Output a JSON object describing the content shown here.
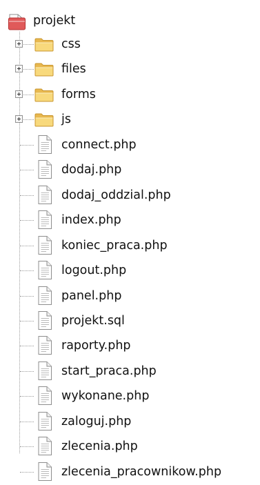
{
  "root": {
    "label": "projekt",
    "icon": "project-icon"
  },
  "folders": [
    {
      "label": "css",
      "icon": "folder-icon",
      "expander": "plus"
    },
    {
      "label": "files",
      "icon": "folder-icon",
      "expander": "plus"
    },
    {
      "label": "forms",
      "icon": "folder-icon",
      "expander": "plus"
    },
    {
      "label": "js",
      "icon": "folder-icon",
      "expander": "plus"
    }
  ],
  "files": [
    {
      "label": "connect.php",
      "icon": "file-icon"
    },
    {
      "label": "dodaj.php",
      "icon": "file-icon"
    },
    {
      "label": "dodaj_oddzial.php",
      "icon": "file-icon"
    },
    {
      "label": "index.php",
      "icon": "file-icon"
    },
    {
      "label": "koniec_praca.php",
      "icon": "file-icon"
    },
    {
      "label": "logout.php",
      "icon": "file-icon"
    },
    {
      "label": "panel.php",
      "icon": "file-icon"
    },
    {
      "label": "projekt.sql",
      "icon": "file-icon"
    },
    {
      "label": "raporty.php",
      "icon": "file-icon"
    },
    {
      "label": "start_praca.php",
      "icon": "file-icon"
    },
    {
      "label": "wykonane.php",
      "icon": "file-icon"
    },
    {
      "label": "zaloguj.php",
      "icon": "file-icon"
    },
    {
      "label": "zlecenia.php",
      "icon": "file-icon"
    },
    {
      "label": "zlecenia_pracownikow.php",
      "icon": "file-icon"
    }
  ],
  "colors": {
    "folder_fill": "#f7d67a",
    "folder_edge": "#d8a640",
    "project_red": "#d23a3a",
    "tree_lines": "#9a9a9a"
  }
}
